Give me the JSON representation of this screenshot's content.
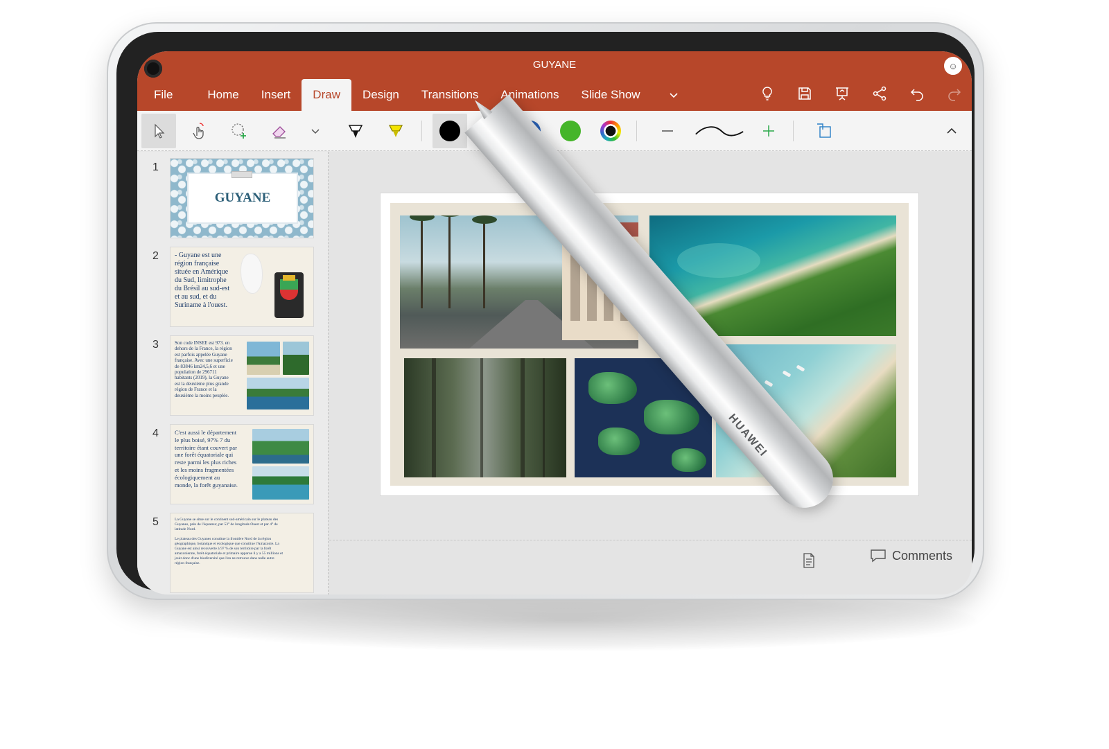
{
  "window": {
    "title": "GUYANE",
    "avatar_glyph": "☺"
  },
  "tabs": [
    {
      "label": "File"
    },
    {
      "label": "Home"
    },
    {
      "label": "Insert"
    },
    {
      "label": "Draw",
      "active": true
    },
    {
      "label": "Design"
    },
    {
      "label": "Transitions"
    },
    {
      "label": "Animations"
    },
    {
      "label": "Slide Show"
    }
  ],
  "draw_tools": {
    "pen_colors": [
      "#000000",
      "#e62e2e",
      "#2a63b8",
      "#45b52a"
    ],
    "selected_color": "#000000",
    "highlighter_color": "#e5d600"
  },
  "thumbnails": [
    {
      "number": "1",
      "title": "GUYANE"
    },
    {
      "number": "2",
      "text": "- Guyane est une\nrégion  française\nsituée en Amérique\ndu Sud, limitrophe\ndu Brésil au sud-est\net au sud, et du\nSuriname à l'ouest."
    },
    {
      "number": "3",
      "text": "Son code INSEE est 973. en\ndehors de la France, la région\nest parfois appelée Guyane\nfrançaise. Avec une superficie\nde 83846 km24,5,6 et une\npopulation de 296711\nhabitants (2019), la Guyane\nest la deuxième plus grande\nrégion de France et la\ndeuxième la moins peuplée."
    },
    {
      "number": "4",
      "text": " C'est aussi le département\nle plus boisé, 97% 7 du\nterritoire étant couvert par\nune forêt équatoriale qui\nreste parmi les plus riches\net les moins fragmentées\nécologiquement au\nmonde, la forêt guyanaise."
    },
    {
      "number": "5",
      "text": "La Guyane se situe sur le continent sud-américain sur le plateau des\nGuyanes, près de l'équateur, par 53° de longitude Ouest et par 4° de\nlatitude Nord.\n\nLe plateau des Guyanes constitue la frontière Nord de la région\ngéographique, botanique et écologique que constitue l'Amazonie. La\nGuyane est ainsi recouverte à 97 % de son territoire par la forêt\namazonienne, forêt équatoriale et primaire apparue il y a 55 millions et\njouit donc d'une biodiversité que l'on ne retrouve dans nulle autre\nrégion française."
    }
  ],
  "stylus": {
    "brand": "HUAWEI"
  },
  "status": {
    "comments_label": "Comments"
  }
}
